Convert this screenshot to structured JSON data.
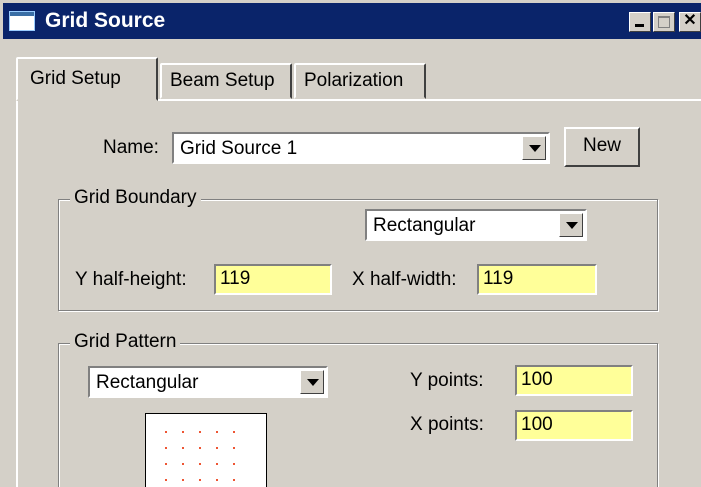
{
  "window": {
    "title": "Grid Source"
  },
  "tabs": [
    {
      "label": "Grid Setup"
    },
    {
      "label": "Beam Setup"
    },
    {
      "label": "Polarization"
    }
  ],
  "name_row": {
    "label": "Name:",
    "value": "Grid Source 1",
    "new_button": "New"
  },
  "grid_boundary": {
    "title": "Grid Boundary",
    "shape": "Rectangular",
    "y_half_height": {
      "label": "Y half-height:",
      "value": "119"
    },
    "x_half_width": {
      "label": "X half-width:",
      "value": "119"
    }
  },
  "grid_pattern": {
    "title": "Grid Pattern",
    "shape": "Rectangular",
    "y_points": {
      "label": "Y points:",
      "value": "100"
    },
    "x_points": {
      "label": "X points:",
      "value": "100"
    }
  },
  "colors": {
    "title_bar": "#0a246a",
    "input_bg": "#ffff99",
    "dialog_bg": "#d4d0c8",
    "grid_dot": "#ee5533"
  },
  "icons": [
    "window-icon",
    "minimize-icon",
    "maximize-icon",
    "close-icon",
    "dropdown-arrow-icon"
  ]
}
